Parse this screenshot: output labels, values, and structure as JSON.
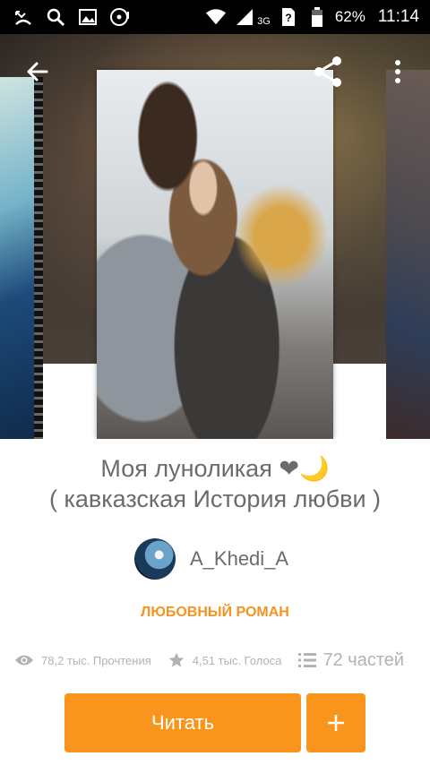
{
  "status_bar": {
    "network": "3G",
    "battery": "62%",
    "time": "11:14"
  },
  "story": {
    "title_line1": "Моя луноликая ❤🌙",
    "title_line2": "( кавказская История любви )",
    "author": "A_Khedi_A",
    "genre": "ЛЮБОВНЫЙ РОМАН",
    "reads": "78,2 тыс. Прочтения",
    "votes": "4,51 тыс. Голоса",
    "parts": "72 частей"
  },
  "actions": {
    "read_label": "Читать"
  },
  "colors": {
    "accent": "#f9951d",
    "genre": "#f59322",
    "text": "#6b6b6b",
    "muted": "#b3b3b3"
  }
}
